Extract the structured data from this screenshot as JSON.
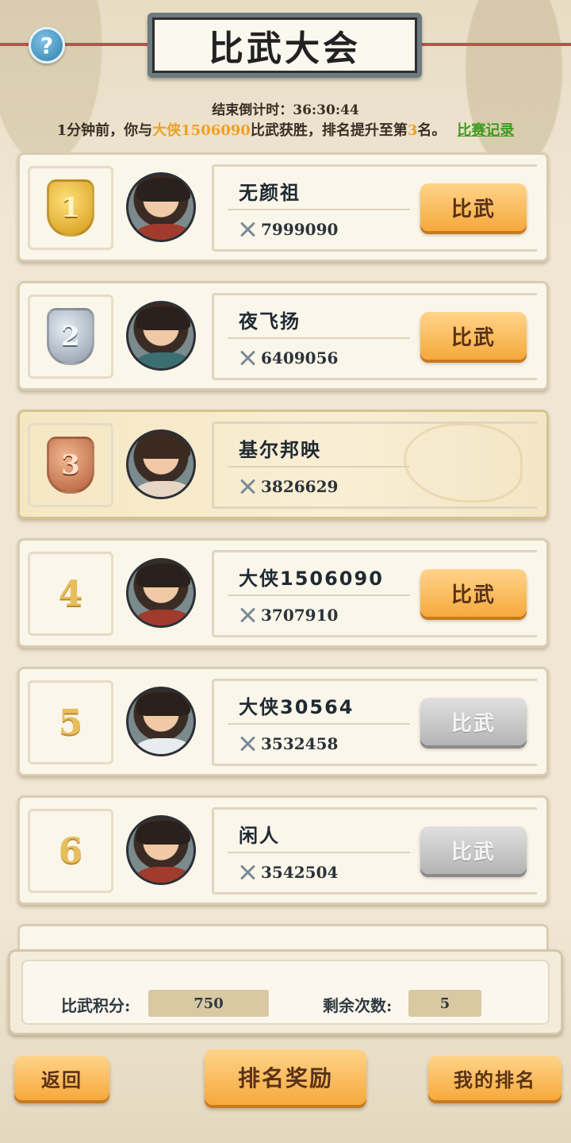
{
  "header": {
    "help_label": "?",
    "title": "比武大会"
  },
  "countdown": {
    "label": "结束倒计时：",
    "value": "36:30:44"
  },
  "news": {
    "prefix": "1分钟前，你与",
    "opponent": "大侠1506090",
    "middle": "比武获胜，排名提升至第",
    "rank": "3",
    "suffix": "名。",
    "record_link": "比赛记录"
  },
  "rankings": [
    {
      "rank": "1",
      "name": "无颜祖",
      "power": "7999090",
      "button": "比武",
      "button_enabled": true
    },
    {
      "rank": "2",
      "name": "夜飞扬",
      "power": "6409056",
      "button": "比武",
      "button_enabled": true
    },
    {
      "rank": "3",
      "name": "基尔邦映",
      "power": "3826629",
      "button": "",
      "button_enabled": false,
      "is_me": true
    },
    {
      "rank": "4",
      "name": "大侠1506090",
      "power": "3707910",
      "button": "比武",
      "button_enabled": true
    },
    {
      "rank": "5",
      "name": "大侠30564",
      "power": "3532458",
      "button": "比武",
      "button_enabled": false
    },
    {
      "rank": "6",
      "name": "闲人",
      "power": "3542504",
      "button": "比武",
      "button_enabled": false
    }
  ],
  "stats": {
    "points_label": "比武积分:",
    "points_value": "750",
    "remaining_label": "剩余次数:",
    "remaining_value": "5"
  },
  "footer": {
    "back": "返回",
    "rank_rewards": "排名奖励",
    "my_rank": "我的排名"
  },
  "icons": {
    "help": "help-icon",
    "power": "crossed-swords-icon"
  },
  "colors": {
    "accent_orange": "#f6a93c",
    "highlight_name": "#f0a020",
    "link_green": "#3f9b1e",
    "disabled_gray": "#b4b4b4"
  }
}
